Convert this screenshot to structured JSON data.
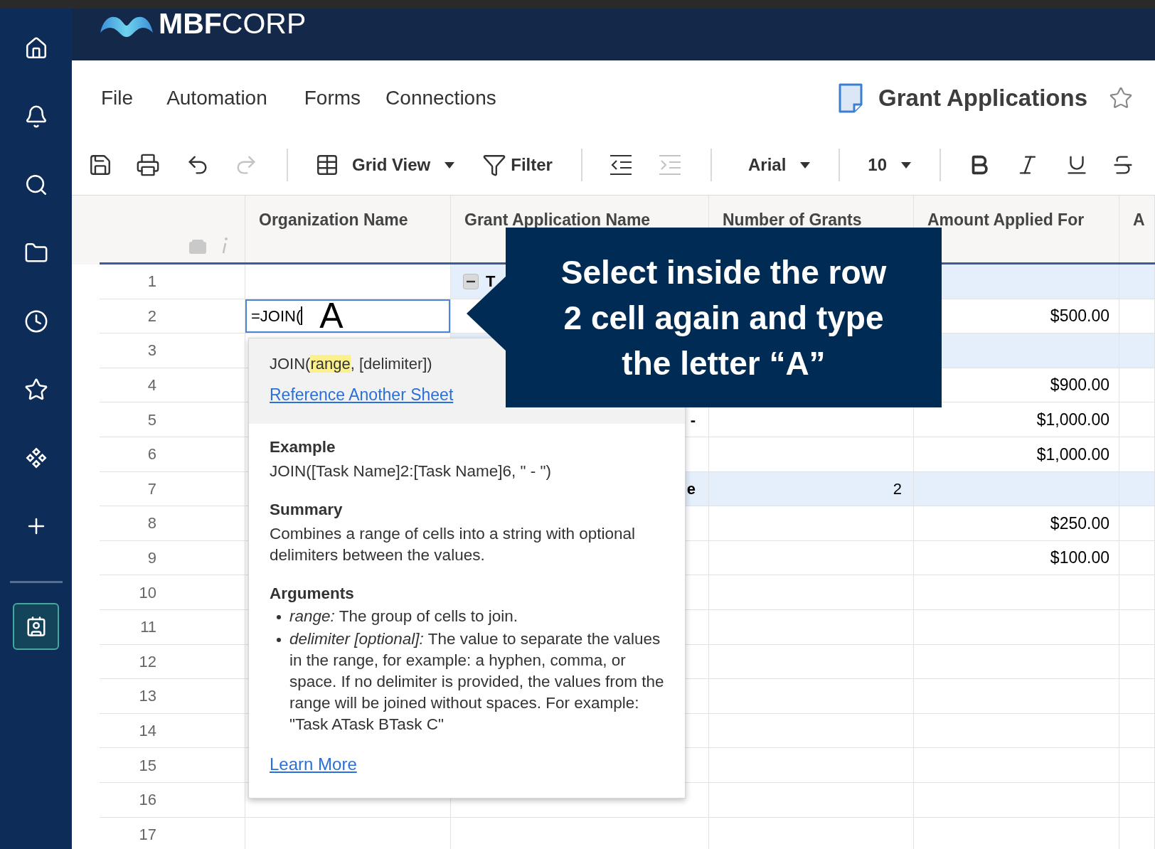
{
  "header": {
    "logo": {
      "bold": "MBF",
      "light": "CORP"
    }
  },
  "sidebar": {
    "items": [
      {
        "selected": false
      },
      {
        "selected": false
      },
      {
        "selected": false
      },
      {
        "selected": false
      },
      {
        "selected": false
      },
      {
        "selected": false
      },
      {
        "selected": false
      },
      {
        "selected": false
      },
      {
        "selected": true
      }
    ]
  },
  "menu": [
    {
      "label": "File"
    },
    {
      "label": "Automation"
    },
    {
      "label": "Forms"
    },
    {
      "label": "Connections"
    }
  ],
  "sheet": {
    "title": "Grant Applications",
    "favorite": false
  },
  "toolbar": {
    "undo": {
      "disabled": false
    },
    "redo": {
      "disabled": true
    },
    "view": {
      "label": "Grid View"
    },
    "filter": {
      "label": "Filter"
    },
    "outdent": {
      "disabled": false
    },
    "indent": {
      "disabled": true
    },
    "font": {
      "value": "Arial"
    },
    "size": {
      "value": "10"
    }
  },
  "table": {
    "columns": [
      "Organization Name",
      "Grant Application Name",
      "Number of Grants",
      "Amount Applied For",
      "A"
    ],
    "rows": [
      {
        "number": "1",
        "group": true,
        "expanded": true,
        "grant": "T"
      },
      {
        "number": "2",
        "group": false,
        "org_input": "=JOIN(",
        "amount": "$500.00"
      },
      {
        "number": "3",
        "group": true
      },
      {
        "number": "4",
        "group": false,
        "amount": "$900.00"
      },
      {
        "number": "5",
        "group": false,
        "grant": "-",
        "amount": "$1,000.00"
      },
      {
        "number": "6",
        "group": false,
        "amount": "$1,000.00"
      },
      {
        "number": "7",
        "group": true,
        "grant": "e",
        "grants": "2"
      },
      {
        "number": "8",
        "group": false,
        "amount": "$250.00"
      },
      {
        "number": "9",
        "group": false,
        "amount": "$100.00"
      },
      {
        "number": "10",
        "group": false
      },
      {
        "number": "11",
        "group": false
      },
      {
        "number": "12",
        "group": false
      },
      {
        "number": "13",
        "group": false
      },
      {
        "number": "14",
        "group": false
      },
      {
        "number": "15",
        "group": false
      },
      {
        "number": "16",
        "group": false
      },
      {
        "number": "17",
        "group": false
      }
    ]
  },
  "formula_help": {
    "syntax": [
      {
        "text": "JOIN(",
        "highlighted": false
      },
      {
        "text": "range",
        "highlighted": true
      },
      {
        "text": ", [delimiter])",
        "highlighted": false
      }
    ],
    "link": "Reference Another Sheet",
    "sections": [
      {
        "kind": "text",
        "heading": "Example",
        "lines": [
          "JOIN([Task Name]2:[Task Name]6, \" - \")"
        ]
      },
      {
        "kind": "text",
        "heading": "Summary",
        "lines": [
          "Combines a range of cells into a string with optional delimiters between the values."
        ]
      },
      {
        "kind": "list",
        "heading": "Arguments",
        "lines": [
          "*range:* The group of cells to join.",
          "*delimiter [optional]:* The value to separate the values in the range, for example: a hyphen, comma, or space. If no delimiter is provided, the values from the range will be joined without spaces. For example: \"Task ATask BTask C\""
        ]
      }
    ],
    "footer_link": "Learn More"
  },
  "callout": {
    "text": "Select inside the row 2 cell again and type the letter “A”",
    "typed_letter": "A"
  }
}
